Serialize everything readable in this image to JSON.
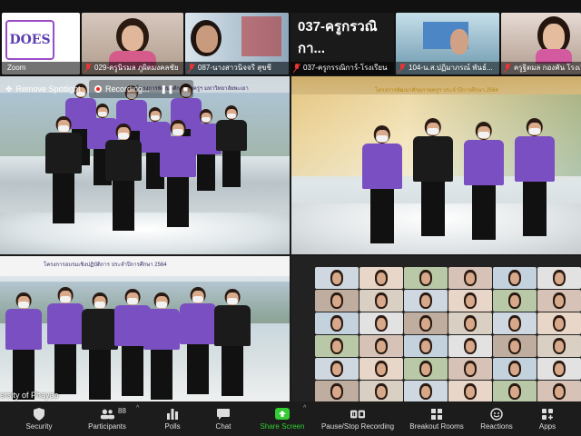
{
  "strip": {
    "thumb0": {
      "label": "Zoom"
    },
    "thumb1": {
      "label": "029-ครูนิรมล ภูผิตมงคลชัย"
    },
    "thumb2": {
      "label": "087-นางสาวนิจจรี สุขชี"
    },
    "thumb3": {
      "label": "037-ครูกรรณิการ์-โรงเรียน",
      "title": "037-ครูกรวณิกา..."
    },
    "thumb4": {
      "label": "104-น.ส.ปฏิมาภรณ์ พันธ์..."
    },
    "thumb5": {
      "label": "ครูฐิตมล กองคัน โรงเรียน"
    }
  },
  "logo": {
    "text": "DOES"
  },
  "spotlight": {
    "label": "Remove Spotlight"
  },
  "recording": {
    "label": "Recording..."
  },
  "tile1": {
    "banner": "โครงการพัฒนาศักยภาพครูฯ มหาวิทยาลัยพะเยา"
  },
  "tile2": {
    "banner": "โครงการพัฒนาศักยภาพครูฯ ประจำปีการศึกษา 2564"
  },
  "tile3": {
    "banner": "โครงการอบรมเชิงปฏิบัติการ ประจำปีการศึกษา 2564",
    "footer": "ersity of Phayao"
  },
  "toolbar": {
    "security": "Security",
    "participants": "Participants",
    "participants_count": "88",
    "polls": "Polls",
    "chat": "Chat",
    "share_screen": "Share Screen",
    "pause_stop": "Pause/Stop Recording",
    "breakout": "Breakout Rooms",
    "reactions": "Reactions",
    "apps": "Apps"
  },
  "colors": {
    "accent_green": "#33cc33",
    "shirt_purple": "#7a4fc2",
    "record_red": "#e22222",
    "toolbar_bg": "#1c1c1c"
  },
  "icons": [
    "shield-icon",
    "participants-icon",
    "polls-icon",
    "chat-icon",
    "share-screen-icon",
    "pause-stop-icon",
    "breakout-rooms-icon",
    "reactions-icon",
    "apps-icon",
    "mic-muted-icon"
  ]
}
